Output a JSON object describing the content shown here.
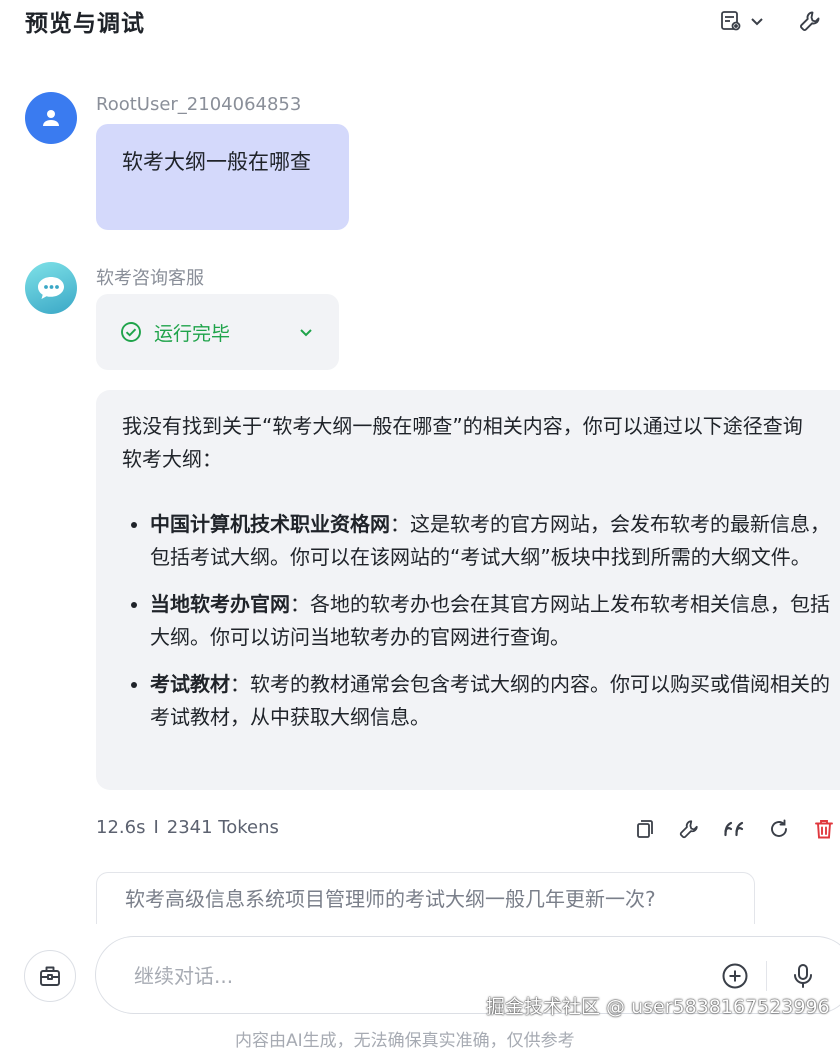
{
  "header": {
    "title": "预览与调试"
  },
  "user_message": {
    "sender": "RootUser_2104064853",
    "text": "软考大纲一般在哪查"
  },
  "bot": {
    "name": "软考咨询客服",
    "status": "运行完毕",
    "answer": {
      "intro": "我没有找到关于“软考大纲一般在哪查”的相关内容，你可以通过以下途径查询软考大纲：",
      "items": [
        {
          "title": "中国计算机技术职业资格网",
          "text": "：这是软考的官方网站，会发布软考的最新信息，包括考试大纲。你可以在该网站的“考试大纲”板块中找到所需的大纲文件。"
        },
        {
          "title": "当地软考办官网",
          "text": "：各地的软考办也会在其官方网站上发布软考相关信息，包括大纲。你可以访问当地软考办的官网进行查询。"
        },
        {
          "title": "考试教材",
          "text": "：软考的教材通常会包含考试大纲的内容。你可以购买或借阅相关的考试教材，从中获取大纲信息。"
        }
      ]
    },
    "stats": {
      "time": "12.6s",
      "separator": "I",
      "tokens": "2341 Tokens"
    }
  },
  "suggestion": "软考高级信息系统项目管理师的考试大纲一般几年更新一次?",
  "input": {
    "placeholder": "继续对话..."
  },
  "watermark": "掘金技术社区 @ user5838167523996",
  "disclaimer": "内容由AI生成，无法确保真实准确，仅供参考",
  "colors": {
    "user_bubble": "#d4d9fb",
    "user_avatar": "#3a7bf0",
    "status_ok": "#1fa34a",
    "delete": "#e0383e",
    "card_bg": "#f2f3f6"
  },
  "icons": [
    "layout-settings-icon",
    "chevron-down-icon",
    "wrench-icon",
    "user-icon",
    "chat-bubble-icon",
    "check-circle-icon",
    "copy-icon",
    "quote-icon",
    "refresh-icon",
    "trash-icon",
    "toolbox-icon",
    "plus-circle-icon",
    "microphone-icon"
  ]
}
